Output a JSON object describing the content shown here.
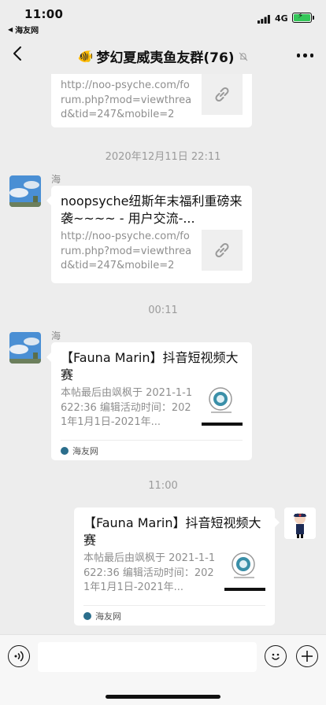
{
  "status": {
    "time": "11:00",
    "back_app": "海友网",
    "network": "4G"
  },
  "nav": {
    "title_emoji": "🐠",
    "title": "梦幻夏威夷鱼友群(76)"
  },
  "messages": [
    {
      "type": "link_partial",
      "desc": "http://noo-psyche.com/forum.php?mod=viewthread&tid=247&mobile=2"
    },
    {
      "type": "timestamp",
      "text": "2020年12月11日 22:11"
    },
    {
      "type": "link",
      "sender": "海",
      "title": "noopsyche纽斯年末福利重磅来袭~~~~ - 用户交流-...",
      "desc": "http://noo-psyche.com/forum.php?mod=viewthread&tid=247&mobile=2"
    },
    {
      "type": "timestamp",
      "text": "00:11"
    },
    {
      "type": "article",
      "sender": "海",
      "title": "【Fauna Marin】抖音短视频大赛",
      "desc": "本帖最后由飒枫于 2021-1-1622:36 编辑活动时间：2021年1月1日-2021年...",
      "source": "海友网"
    },
    {
      "type": "timestamp",
      "text": "11:00"
    },
    {
      "type": "article_self",
      "title": "【Fauna Marin】抖音短视频大赛",
      "desc": "本帖最后由飒枫于 2021-1-1622:36 编辑活动时间：2021年1月1日-2021年...",
      "source": "海友网"
    }
  ],
  "input": {
    "placeholder": ""
  },
  "colors": {
    "background": "#EDEDED",
    "bubble": "#FFFFFF",
    "timestamp": "#9B9B9B",
    "battery": "#34C759"
  }
}
